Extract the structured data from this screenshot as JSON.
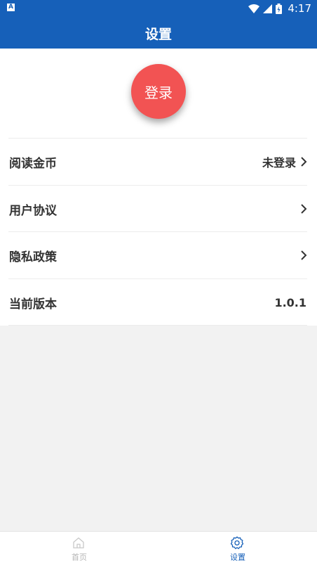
{
  "status_bar": {
    "time": "4:17"
  },
  "header": {
    "title": "设置"
  },
  "login": {
    "label": "登录"
  },
  "settings": {
    "rows": [
      {
        "label": "阅读金币",
        "value": "未登录"
      },
      {
        "label": "用户协议"
      },
      {
        "label": "隐私政策"
      },
      {
        "label": "当前版本",
        "value": "1.0.1"
      }
    ]
  },
  "bottom_nav": {
    "items": [
      {
        "label": "首页",
        "icon": "home-icon",
        "active": false
      },
      {
        "label": "设置",
        "icon": "settings-icon",
        "active": true
      }
    ]
  },
  "colors": {
    "primary": "#1660b9",
    "login_button": "#f25353",
    "active_tab": "#1660b9",
    "inactive_tab": "#b5b5b5"
  }
}
